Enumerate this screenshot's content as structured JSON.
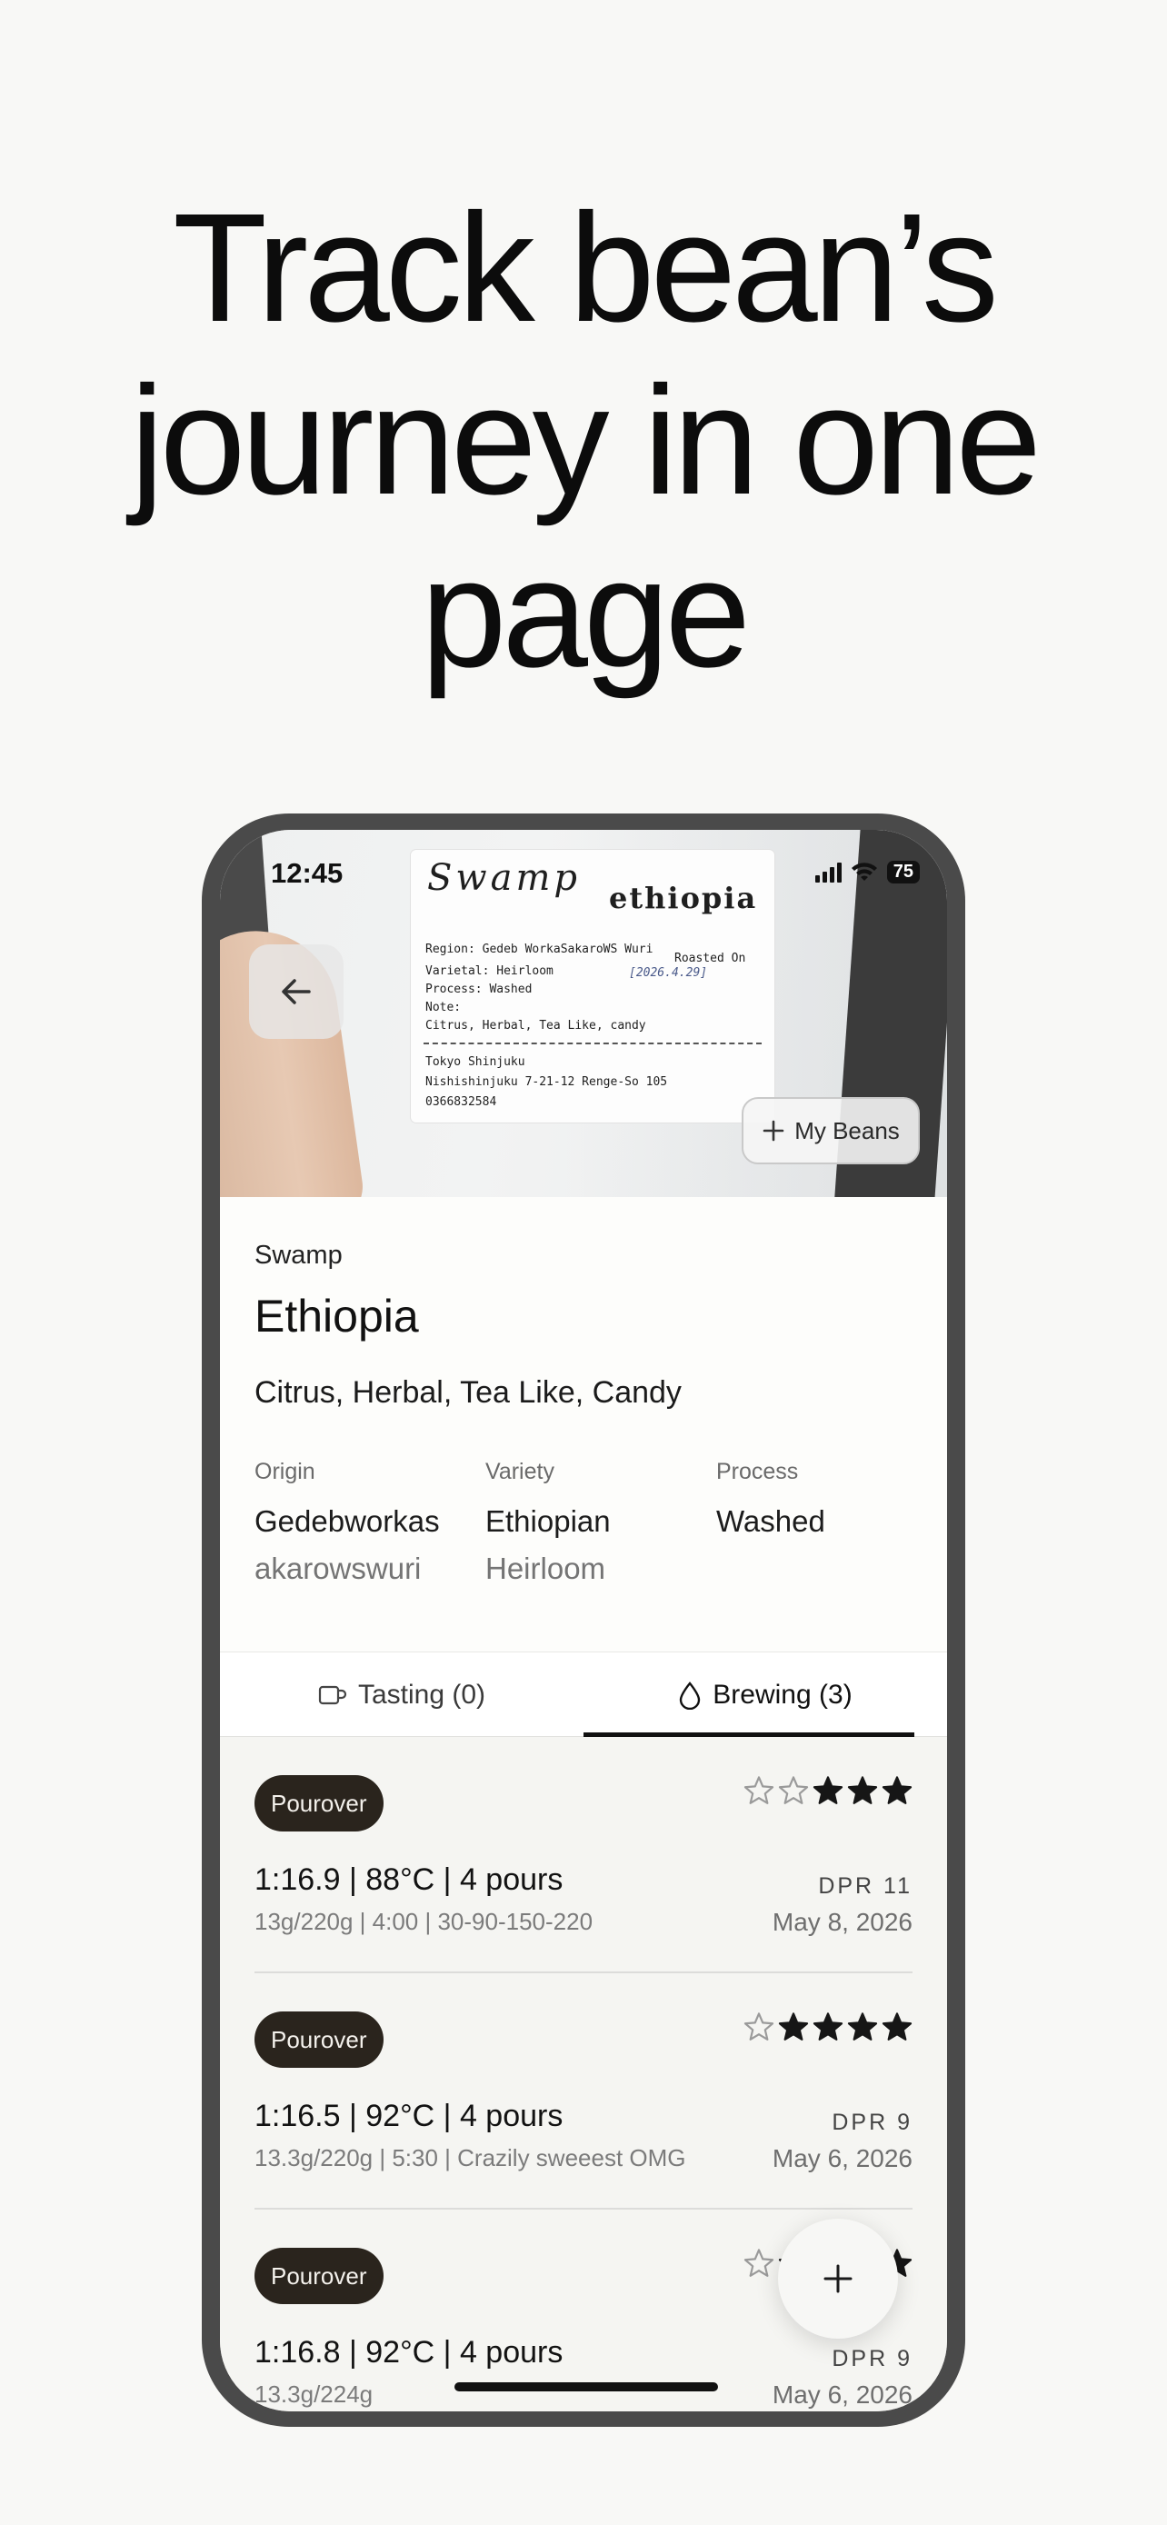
{
  "headline": {
    "line1": "Track bean’s",
    "line2": "journey in one",
    "line3": "page"
  },
  "status_bar": {
    "time": "12:45",
    "battery": "75"
  },
  "bag_label": {
    "brand": "Swamp",
    "origin": "ethiopia",
    "region": "Region: Gedeb WorkaSakaroWS Wuri",
    "roasted_on": "Roasted On",
    "roast_date": "[2026.4.29]",
    "varietal": "Varietal: Heirloom",
    "process": "Process: Washed",
    "note": "Note:",
    "flavors": "Citrus, Herbal, Tea Like, candy",
    "address1": "Tokyo Shinjuku",
    "address2": "Nishishinjuku 7-21-12 Renge-So 105",
    "phone": "0366832584"
  },
  "header": {
    "my_beans_label": "My Beans"
  },
  "bean": {
    "roaster": "Swamp",
    "name": "Ethiopia",
    "tasting_notes": "Citrus, Herbal, Tea Like, Candy",
    "attributes": [
      {
        "label": "Origin",
        "line1": "Gedebworkas",
        "line2": "akarowswuri"
      },
      {
        "label": "Variety",
        "line1": "Ethiopian",
        "line2": "Heirloom"
      },
      {
        "label": "Process",
        "line1": "Washed",
        "line2": ""
      }
    ]
  },
  "tabs": [
    {
      "label": "Tasting (0)",
      "active": false
    },
    {
      "label": "Brewing (3)",
      "active": true
    }
  ],
  "brews": [
    {
      "method": "Pourover",
      "rating": 3,
      "ratio": "1:16.9 | 88°C | 4 pours",
      "recipe": "13g/220g | 4:00 | 30-90-150-220",
      "dpr": "DPR 11",
      "date": "May 8, 2026"
    },
    {
      "method": "Pourover",
      "rating": 4,
      "ratio": "1:16.5 | 92°C | 4 pours",
      "recipe": "13.3g/220g | 5:30 | Crazily sweeest OMG",
      "dpr": "DPR 9",
      "date": "May 6, 2026"
    },
    {
      "method": "Pourover",
      "rating": 4,
      "ratio": "1:16.8 | 92°C | 4 pours",
      "recipe": "13.3g/224g",
      "dpr": "DPR 9",
      "date": "May 6, 2026"
    }
  ],
  "icons": {
    "back": "arrow-left-icon",
    "add": "plus-icon",
    "tasting": "cup-icon",
    "brewing": "drop-icon"
  }
}
